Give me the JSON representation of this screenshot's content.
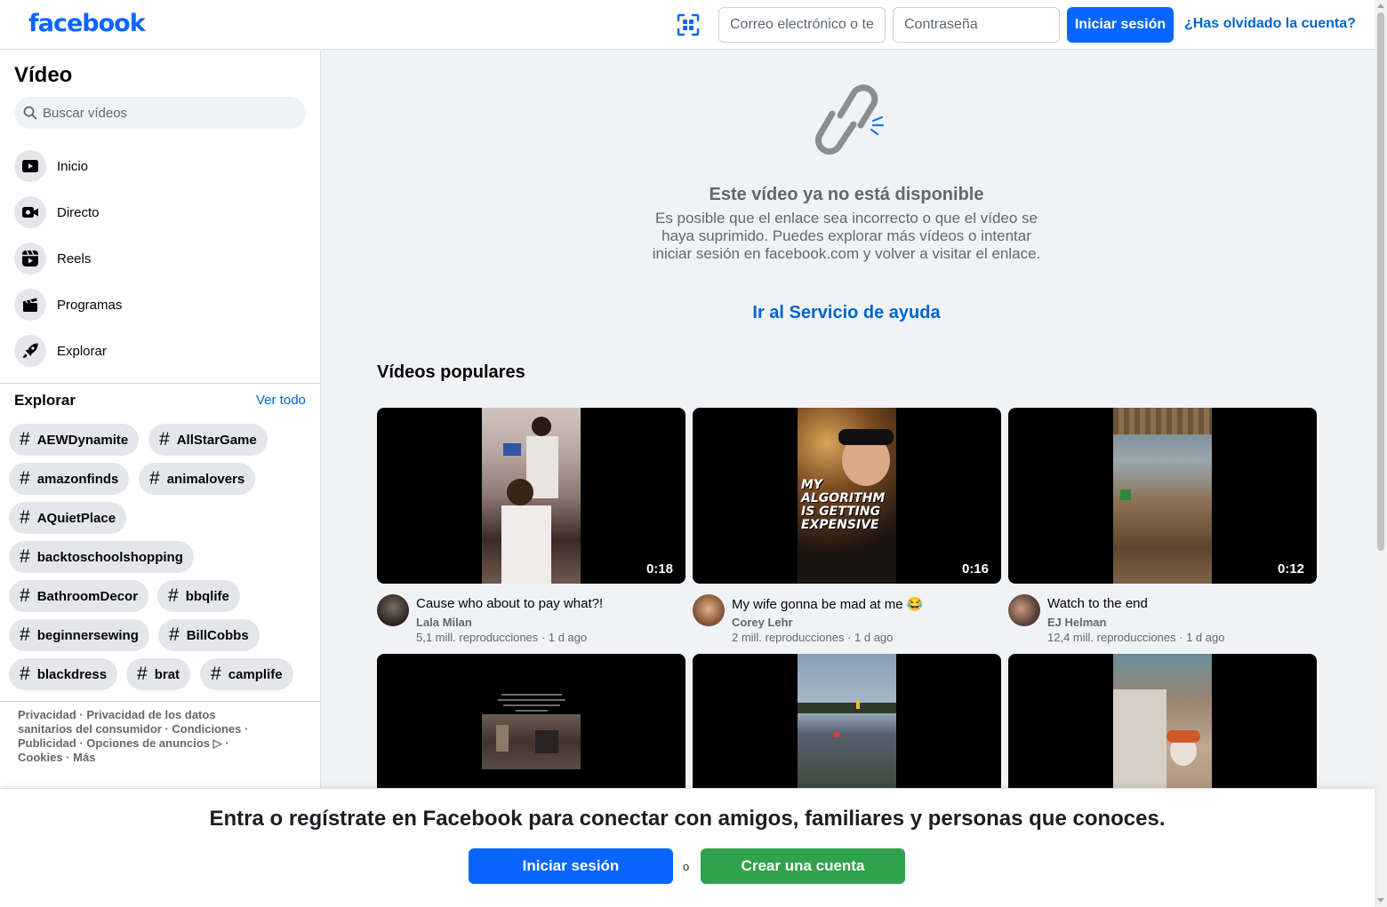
{
  "header": {
    "logo": "facebook",
    "email_placeholder": "Correo electrónico o teléfono",
    "password_placeholder": "Contraseña",
    "login_label": "Iniciar sesión",
    "forgot_label": "¿Has olvidado la cuenta?"
  },
  "sidebar": {
    "title": "Vídeo",
    "search_placeholder": "Buscar vídeos",
    "nav": [
      {
        "label": "Inicio",
        "icon": "video-play-icon"
      },
      {
        "label": "Directo",
        "icon": "live-camera-icon"
      },
      {
        "label": "Reels",
        "icon": "reels-icon"
      },
      {
        "label": "Programas",
        "icon": "clapperboard-icon"
      },
      {
        "label": "Explorar",
        "icon": "rocket-icon"
      }
    ],
    "explore_title": "Explorar",
    "see_all": "Ver todo",
    "tags": [
      "AEWDynamite",
      "AllStarGame",
      "amazonfinds",
      "animalovers",
      "AQuietPlace",
      "backtoschoolshopping",
      "BathroomDecor",
      "bbqlife",
      "beginnersewing",
      "BillCobbs",
      "blackdress",
      "brat",
      "camplife"
    ],
    "footer": {
      "privacy": "Privacidad",
      "health_privacy": "Privacidad de los datos sanitarios del consumidor",
      "terms": "Condiciones",
      "ads": "Publicidad",
      "ad_choices": "Opciones de anuncios",
      "cookies": "Cookies",
      "more": "Más",
      "sep": " · "
    }
  },
  "main": {
    "unavailable_title": "Este vídeo ya no está disponible",
    "unavailable_text": "Es posible que el enlace sea incorrecto o que el vídeo se haya suprimido. Puedes explorar más vídeos o intentar iniciar sesión en facebook.com y volver a visitar el enlace.",
    "help_link": "Ir al Servicio de ayuda",
    "popular_title": "Vídeos populares",
    "videos": [
      {
        "title": "Cause who about to pay what?!",
        "author": "Lala Milan",
        "views": "5,1 mill. reproducciones",
        "age": "1 d ago",
        "duration": "0:18"
      },
      {
        "title": "My wife gonna be mad at me 😂",
        "author": "Corey Lehr",
        "views": "2 mill. reproducciones",
        "age": "1 d ago",
        "duration": "0:16",
        "overlay": "MY ALGORITHM IS GETTING EXPENSIVE"
      },
      {
        "title": "Watch to the end",
        "author": "EJ Helman",
        "views": "12,4 mill. reproducciones",
        "age": "1 d ago",
        "duration": "0:12"
      }
    ]
  },
  "banner": {
    "text": "Entra o regístrate en Facebook para conectar con amigos, familiares y personas que conoces.",
    "login_label": "Iniciar sesión",
    "or": "o",
    "create_label": "Crear una cuenta"
  }
}
